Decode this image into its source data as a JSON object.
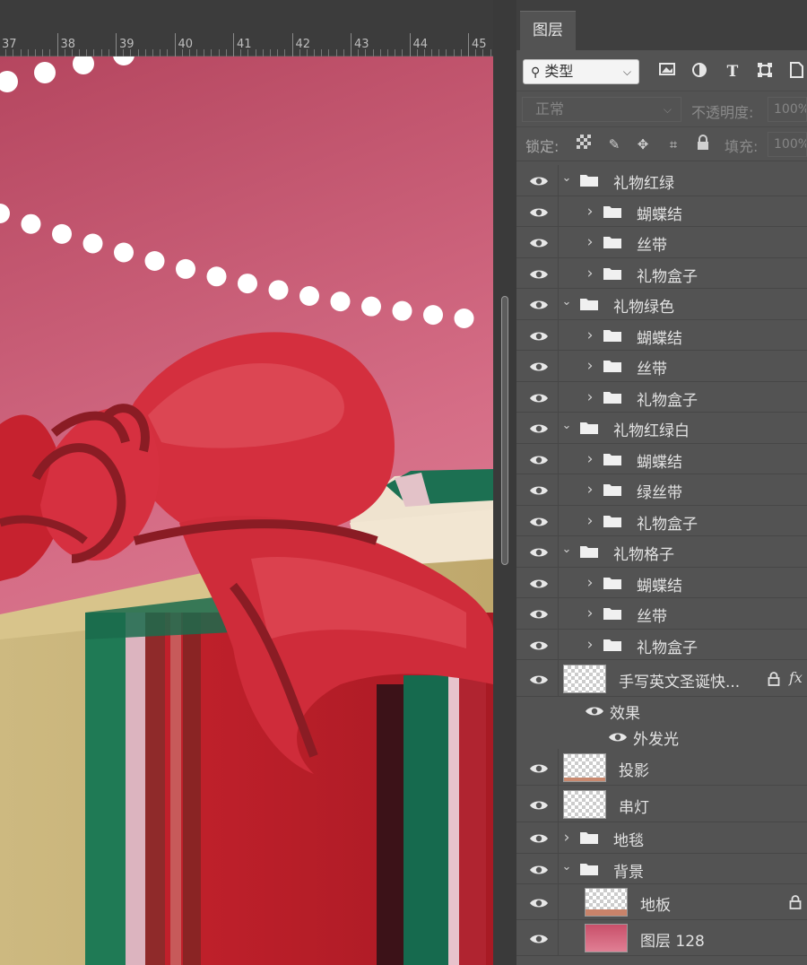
{
  "ruler": {
    "labels": [
      "37",
      "38",
      "39",
      "40",
      "41",
      "42",
      "43",
      "44",
      "45"
    ]
  },
  "panel": {
    "tab_label": "图层",
    "filter": {
      "kind_label": "类型",
      "icons": [
        "image-filter-icon",
        "adjustment-filter-icon",
        "text-filter-icon",
        "shape-filter-icon",
        "smart-object-filter-icon"
      ]
    },
    "blend_mode": "正常",
    "opacity_label": "不透明度:",
    "opacity_value": "100%",
    "lock_label": "锁定:",
    "fill_label": "填充:",
    "fill_value": "100%"
  },
  "layers": [
    {
      "name": "礼物红绿",
      "kind": "group",
      "indent": 0,
      "expanded": true
    },
    {
      "name": "蝴蝶结",
      "kind": "group",
      "indent": 1,
      "expanded": false
    },
    {
      "name": "丝带",
      "kind": "group",
      "indent": 1,
      "expanded": false
    },
    {
      "name": "礼物盒子",
      "kind": "group",
      "indent": 1,
      "expanded": false
    },
    {
      "name": "礼物绿色",
      "kind": "group",
      "indent": 0,
      "expanded": true
    },
    {
      "name": "蝴蝶结",
      "kind": "group",
      "indent": 1,
      "expanded": false
    },
    {
      "name": "丝带",
      "kind": "group",
      "indent": 1,
      "expanded": false
    },
    {
      "name": "礼物盒子",
      "kind": "group",
      "indent": 1,
      "expanded": false
    },
    {
      "name": "礼物红绿白",
      "kind": "group",
      "indent": 0,
      "expanded": true
    },
    {
      "name": "蝴蝶结",
      "kind": "group",
      "indent": 1,
      "expanded": false
    },
    {
      "name": "绿丝带",
      "kind": "group",
      "indent": 1,
      "expanded": false
    },
    {
      "name": "礼物盒子",
      "kind": "group",
      "indent": 1,
      "expanded": false
    },
    {
      "name": "礼物格子",
      "kind": "group",
      "indent": 0,
      "expanded": true
    },
    {
      "name": "蝴蝶结",
      "kind": "group",
      "indent": 1,
      "expanded": false
    },
    {
      "name": "丝带",
      "kind": "group",
      "indent": 1,
      "expanded": false
    },
    {
      "name": "礼物盒子",
      "kind": "group",
      "indent": 1,
      "expanded": false
    },
    {
      "name": "手写英文圣诞快...",
      "kind": "layer",
      "indent": 0,
      "locked": true,
      "fx": true,
      "thumb": "transparent"
    },
    {
      "name": "效果",
      "kind": "effects",
      "indent": 0
    },
    {
      "name": "外发光",
      "kind": "effect",
      "indent": 1
    },
    {
      "name": "投影",
      "kind": "layer",
      "indent": 0,
      "thumb": "transparent-stripe"
    },
    {
      "name": "串灯",
      "kind": "layer",
      "indent": 0,
      "thumb": "transparent"
    },
    {
      "name": "地毯",
      "kind": "group",
      "indent": 0,
      "expanded": false
    },
    {
      "name": "背景",
      "kind": "group",
      "indent": 0,
      "expanded": true
    },
    {
      "name": "地板",
      "kind": "layer",
      "indent": 1,
      "locked": true,
      "thumb": "floor"
    },
    {
      "name": "图层 128",
      "kind": "layer",
      "indent": 1,
      "thumb": "pink"
    }
  ],
  "fx_label": "fx",
  "colors": {
    "canvas_bg_top": "#b84a62",
    "canvas_bg_bottom": "#e08196",
    "ribbon_red": "#d3313f",
    "ribbon_dark": "#8a1c24",
    "box_red": "#b81f2a",
    "box_green": "#1a6a4e",
    "box_beige": "#c9b57d",
    "panel_bg": "#535353"
  }
}
